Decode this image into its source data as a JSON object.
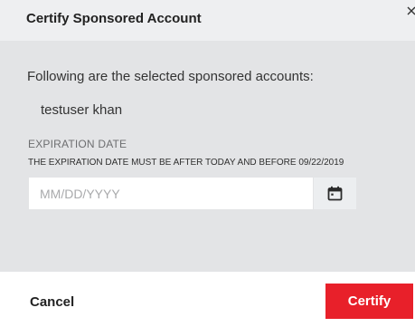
{
  "dialog": {
    "title": "Certify Sponsored Account",
    "close_icon": "close-icon"
  },
  "body": {
    "intro_text": "Following are the selected sponsored accounts:",
    "accounts": [
      "testuser khan"
    ],
    "expiration": {
      "label": "EXPIRATION DATE",
      "note": "THE EXPIRATION DATE MUST BE AFTER TODAY AND BEFORE 09/22/2019",
      "value": "",
      "placeholder": "MM/DD/YYYY",
      "calendar_icon": "calendar-icon"
    }
  },
  "footer": {
    "cancel_label": "Cancel",
    "certify_label": "Certify"
  },
  "colors": {
    "header_bg": "#eeeff1",
    "body_bg": "#e3e4e6",
    "primary": "#e8202a"
  }
}
